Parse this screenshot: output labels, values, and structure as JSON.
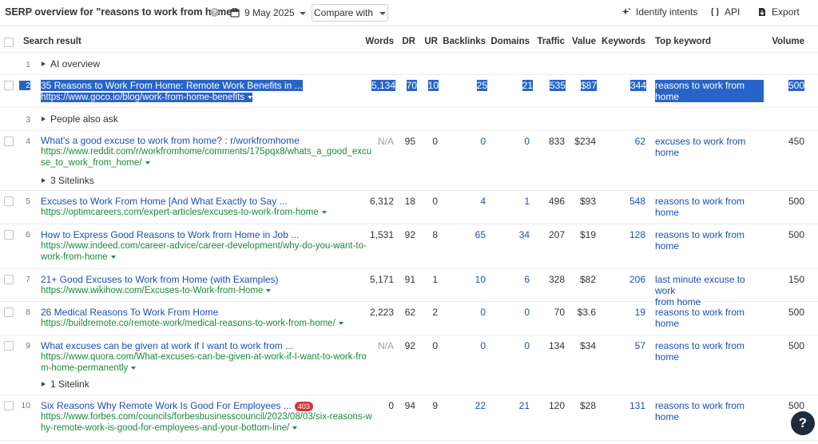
{
  "header": {
    "title": "SERP overview for \"reasons to work from home\"",
    "date": "9 May 2025",
    "compare_label": "Compare with",
    "identify_label": "Identify intents",
    "api_label": "API",
    "export_label": "Export"
  },
  "columns": {
    "search_result": "Search result",
    "words": "Words",
    "dr": "DR",
    "ur": "UR",
    "backlinks": "Backlinks",
    "domains": "Domains",
    "traffic": "Traffic",
    "value": "Value",
    "keywords": "Keywords",
    "top_keyword": "Top keyword",
    "volume": "Volume"
  },
  "rows": [
    {
      "pos": "1",
      "label": "AI overview"
    },
    {
      "pos": "2",
      "title": "35 Reasons to Work From Home: Remote Work Benefits in ...",
      "url": "https://www.goco.io/blog/work-from-home-benefits",
      "words": "5,134",
      "dr": "70",
      "ur": "10",
      "backlinks": "25",
      "domains": "21",
      "traffic": "535",
      "value": "$87",
      "keywords": "344",
      "top_keyword": "reasons to work from home",
      "volume": "500"
    },
    {
      "pos": "3",
      "label": "People also ask"
    },
    {
      "pos": "4",
      "title": "What's a good excuse to work from home? : r/workfromhome",
      "url1": "https://www.reddit.com/r/workfromhome/comments/175pqx8/whats_a_good_excu",
      "url2": "se_to_work_from_home/",
      "words": "N/A",
      "dr": "95",
      "ur": "0",
      "backlinks": "0",
      "domains": "0",
      "traffic": "833",
      "value": "$234",
      "keywords": "62",
      "top_keyword": "excuses to work from home",
      "volume": "450",
      "sitelinks": "3 Sitelinks"
    },
    {
      "pos": "5",
      "title": "Excuses to Work From Home [And What Exactly to Say ...",
      "url": "https://optimcareers.com/expert-articles/excuses-to-work-from-home",
      "words": "6,312",
      "dr": "18",
      "ur": "0",
      "backlinks": "4",
      "domains": "1",
      "traffic": "496",
      "value": "$93",
      "keywords": "548",
      "top_keyword": "reasons to work from home",
      "volume": "500"
    },
    {
      "pos": "6",
      "title": "How to Express Good Reasons to Work from Home in Job ...",
      "url1": "https://www.indeed.com/career-advice/career-development/why-do-you-want-to-",
      "url2": "work-from-home",
      "words": "1,531",
      "dr": "92",
      "ur": "8",
      "backlinks": "65",
      "domains": "34",
      "traffic": "207",
      "value": "$19",
      "keywords": "128",
      "top_keyword": "reasons to work from home",
      "volume": "500"
    },
    {
      "pos": "7",
      "title": "21+ Good Excuses to Work from Home (with Examples)",
      "url": "https://www.wikihow.com/Excuses-to-Work-from-Home",
      "words": "5,171",
      "dr": "91",
      "ur": "1",
      "backlinks": "10",
      "domains": "6",
      "traffic": "328",
      "value": "$82",
      "keywords": "206",
      "top_keyword1": "last minute excuse to work",
      "top_keyword2": "from home",
      "volume": "150"
    },
    {
      "pos": "8",
      "title": "26 Medical Reasons To Work From Home",
      "url": "https://buildremote.co/remote-work/medical-reasons-to-work-from-home/",
      "words": "2,223",
      "dr": "62",
      "ur": "2",
      "backlinks": "0",
      "domains": "0",
      "traffic": "70",
      "value": "$3.6",
      "keywords": "19",
      "top_keyword": "reasons to work from home",
      "volume": "500"
    },
    {
      "pos": "9",
      "title": "What excuses can be given at work if I want to work from ...",
      "url1": "https://www.quora.com/What-excuses-can-be-given-at-work-if-I-want-to-work-fro",
      "url2": "m-home-permanently",
      "words": "N/A",
      "dr": "92",
      "ur": "0",
      "backlinks": "0",
      "domains": "0",
      "traffic": "134",
      "value": "$34",
      "keywords": "57",
      "top_keyword": "reasons to work from home",
      "volume": "500",
      "sitelinks": "1 Sitelink"
    },
    {
      "pos": "10",
      "title": "Six Reasons Why Remote Work Is Good For Employees ...",
      "badge": "403",
      "url1": "https://www.forbes.com/councils/forbesbusinesscouncil/2023/08/03/six-reasons-w",
      "url2": "hy-remote-work-is-good-for-employees-and-your-bottom-line/",
      "words": "0",
      "dr": "94",
      "ur": "9",
      "backlinks": "22",
      "domains": "21",
      "traffic": "120",
      "value": "$28",
      "keywords": "131",
      "top_keyword": "reasons to work from home",
      "volume": "500"
    }
  ],
  "help_fab": "?",
  "help_icon": "?",
  "colors": {
    "link": "#1a4fb8",
    "url": "#1a8a3a",
    "selection": "#2864c8",
    "badge": "#d93434"
  }
}
